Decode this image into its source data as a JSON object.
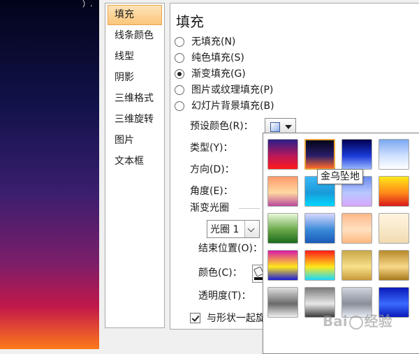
{
  "left_strip": {
    "cut_text": "）."
  },
  "nav": {
    "items": [
      {
        "label": "填充",
        "selected": true
      },
      {
        "label": "线条颜色",
        "selected": false
      },
      {
        "label": "线型",
        "selected": false
      },
      {
        "label": "阴影",
        "selected": false
      },
      {
        "label": "三维格式",
        "selected": false
      },
      {
        "label": "三维旋转",
        "selected": false
      },
      {
        "label": "图片",
        "selected": false
      },
      {
        "label": "文本框",
        "selected": false
      }
    ]
  },
  "panel": {
    "title": "填充",
    "fill_options": [
      {
        "label": "无填充(N)",
        "selected": false
      },
      {
        "label": "纯色填充(S)",
        "selected": false
      },
      {
        "label": "渐变填充(G)",
        "selected": true
      },
      {
        "label": "图片或纹理填充(P)",
        "selected": false
      },
      {
        "label": "幻灯片背景填充(B)",
        "selected": false
      }
    ],
    "preset_label": "预设颜色(R)",
    "type_label": "类型(Y)",
    "direction_label": "方向(D)",
    "angle_label": "角度(E)",
    "stops_section": "渐变光圈",
    "stop_value": "光圈 1",
    "end_position_label": "结束位置(O)",
    "color_label": "颜色(C)",
    "transparency_label": "透明度(T)",
    "rotate_with_shape": "与形状一起旋"
  },
  "gallery": {
    "tooltip": "金乌坠地",
    "swatches": [
      {
        "name": "row1-col1",
        "colors": [
          "#2a1e8a",
          "#b8185a",
          "#ff1a1a"
        ]
      },
      {
        "name": "row1-col2",
        "colors": [
          "#020418",
          "#2a1e6a",
          "#ff6a2a"
        ]
      },
      {
        "name": "row1-col3",
        "colors": [
          "#000050",
          "#1a3ad8",
          "#9ab8ff"
        ]
      },
      {
        "name": "row1-col4",
        "colors": [
          "#7aa8f0",
          "#cfe0ff",
          "#ffffff"
        ]
      },
      {
        "name": "row2-col1",
        "colors": [
          "#ff9a6a",
          "#ffd8a0",
          "#b84a9a"
        ]
      },
      {
        "name": "row2-col2",
        "colors": [
          "#3ab8f8",
          "#1a9ad8",
          "#00d8ff"
        ]
      },
      {
        "name": "row2-col3",
        "colors": [
          "#6a8af0",
          "#b8c8ff",
          "#d8a8ff"
        ]
      },
      {
        "name": "row2-col4",
        "colors": [
          "#ffe81a",
          "#ff8a1a",
          "#d81a1a"
        ]
      },
      {
        "name": "row3-col1",
        "colors": [
          "#e8f8d8",
          "#6aa84a",
          "#1a6a1a"
        ]
      },
      {
        "name": "row3-col2",
        "colors": [
          "#d8d8ff",
          "#3a8ad8",
          "#1a5ab8"
        ]
      },
      {
        "name": "row3-col3",
        "colors": [
          "#ffb88a",
          "#ffe0c0",
          "#ffb880"
        ]
      },
      {
        "name": "row3-col4",
        "colors": [
          "#fff4e0",
          "#f8e8c8",
          "#f0dab0"
        ]
      },
      {
        "name": "row4-col1",
        "colors": [
          "#d81aa8",
          "#ffe81a",
          "#1a1ad8"
        ]
      },
      {
        "name": "row4-col2",
        "colors": [
          "#ff1a1a",
          "#ffe81a",
          "#1ad8ff"
        ]
      },
      {
        "name": "row4-col3",
        "colors": [
          "#c8a84a",
          "#f8e08a",
          "#c89a3a"
        ]
      },
      {
        "name": "row4-col4",
        "colors": [
          "#b88a2a",
          "#f8d88a",
          "#a87a1a"
        ]
      },
      {
        "name": "row5-col1",
        "colors": [
          "#e0e0e0",
          "#6a6a6a",
          "#f0f0f0"
        ]
      },
      {
        "name": "row5-col2",
        "colors": [
          "#7a7a7a",
          "#e8e8e8",
          "#3a3a3a"
        ]
      },
      {
        "name": "row5-col3",
        "colors": [
          "#d0d4dc",
          "#8a8e9a",
          "#e8ecf4"
        ]
      },
      {
        "name": "row5-col4",
        "colors": [
          "#0a1ab8",
          "#3a6aff",
          "#0a1ab8"
        ]
      }
    ]
  },
  "watermark": {
    "text_left": "Bai",
    "text_right": "经验"
  }
}
